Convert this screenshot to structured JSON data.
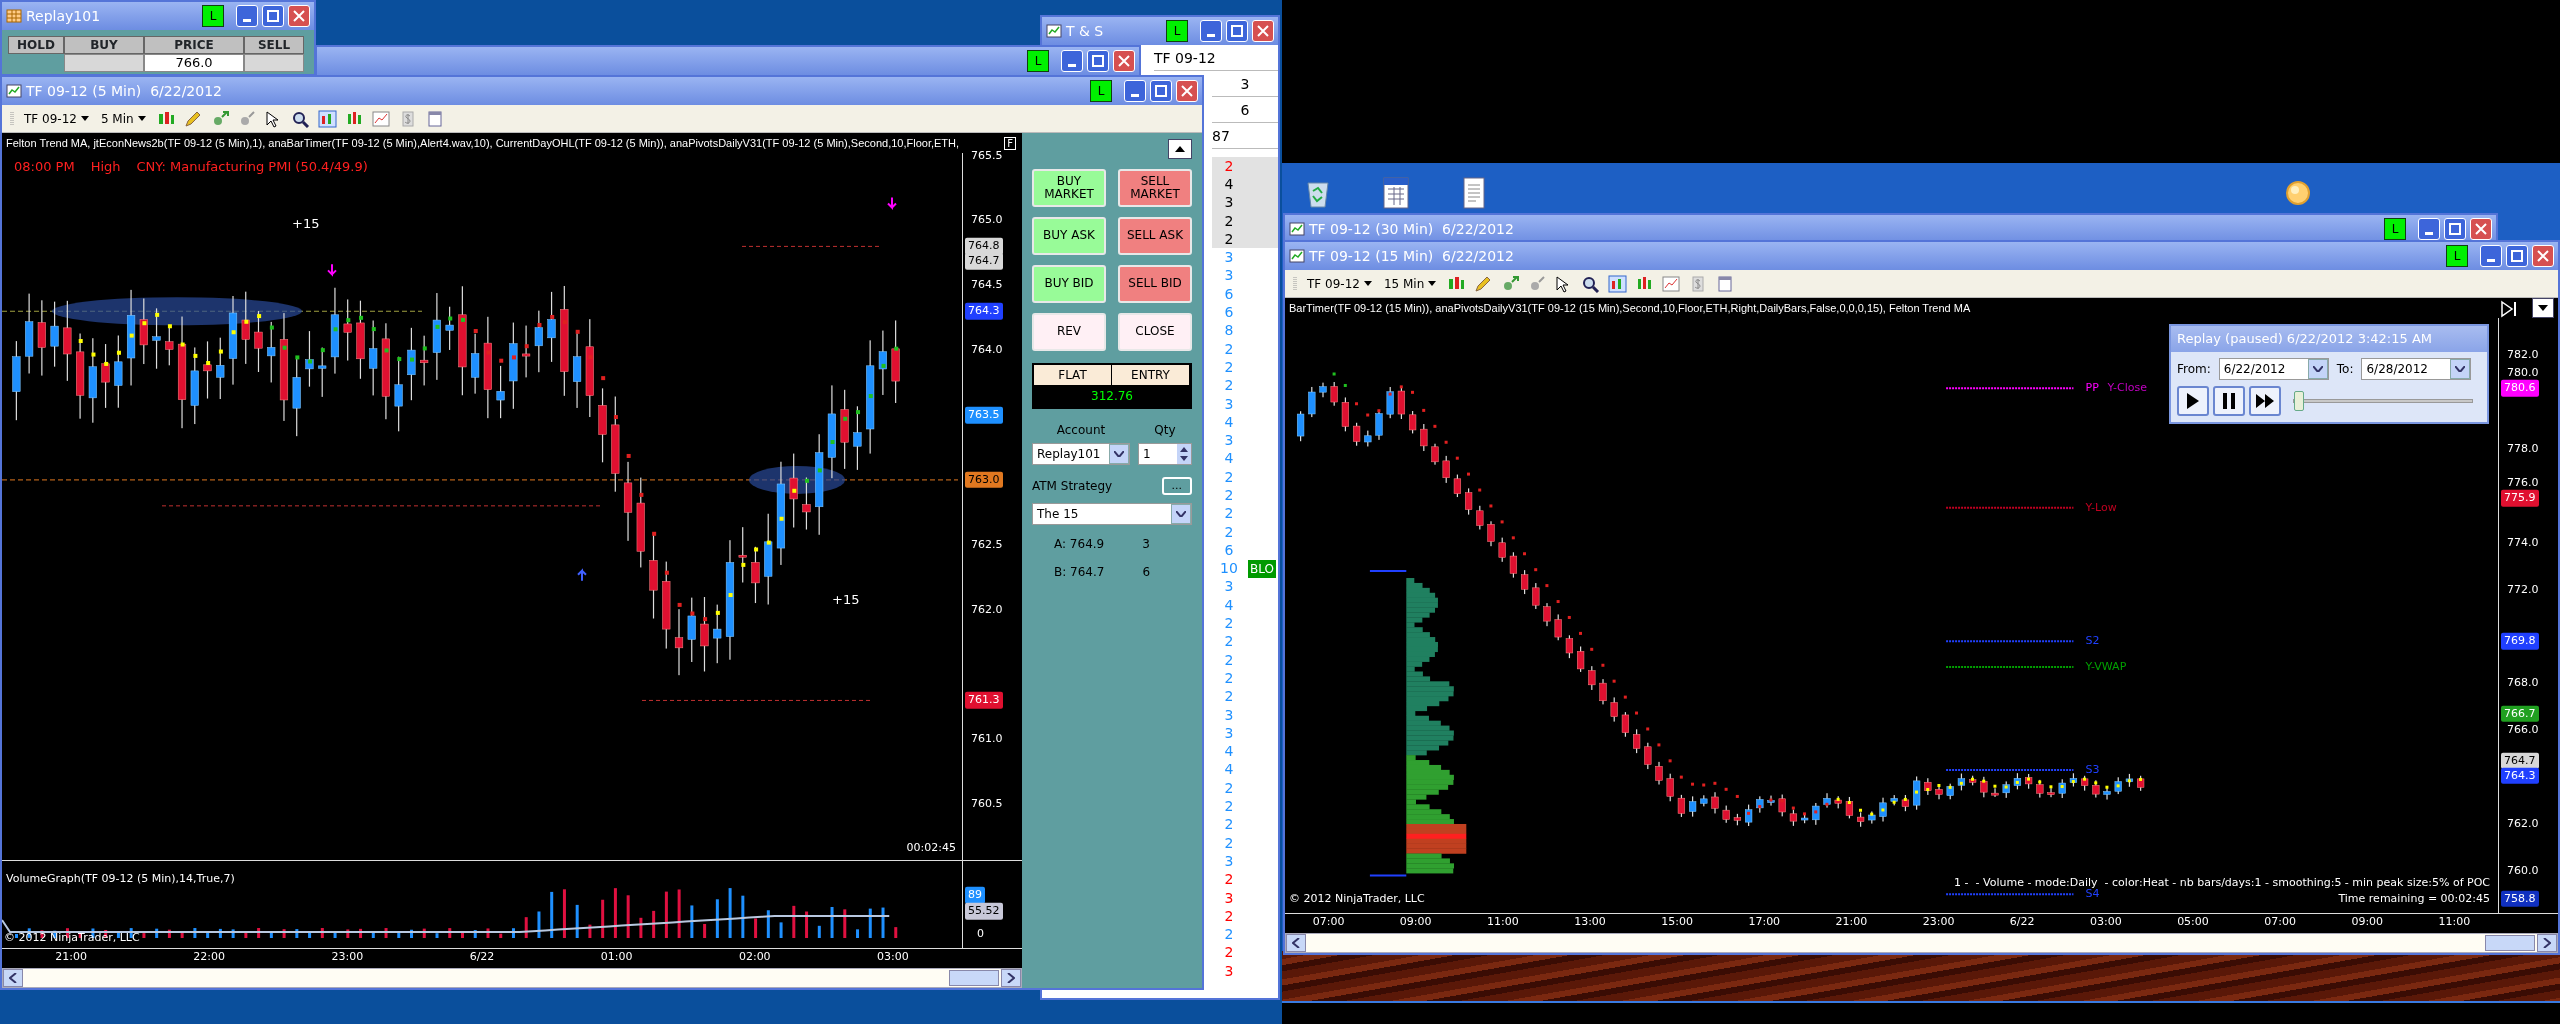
{
  "replay_account": {
    "title": "Replay101",
    "badge": "L",
    "columns": [
      "HOLD",
      "BUY",
      "PRICE",
      "SELL"
    ],
    "price": "766.0"
  },
  "hidden_window": {
    "badge": "L"
  },
  "time_and_sales": {
    "title": "T & S",
    "badge": "L",
    "header": [
      "TF 09-12",
      "3",
      "6",
      "87"
    ],
    "rows": [
      {
        "size": "2",
        "color": "#ff0000",
        "shaded": true
      },
      {
        "size": "4",
        "color": "#000000",
        "shaded": true
      },
      {
        "size": "3",
        "color": "#000000",
        "shaded": true
      },
      {
        "size": "2",
        "color": "#000000",
        "shaded": true
      },
      {
        "size": "2",
        "color": "#000000",
        "shaded": true
      },
      {
        "size": "3",
        "color": "#1e90ff",
        "shaded": false
      },
      {
        "size": "3",
        "color": "#1e90ff",
        "shaded": false
      },
      {
        "size": "6",
        "color": "#1e90ff",
        "shaded": false
      },
      {
        "size": "6",
        "color": "#1e90ff",
        "shaded": false
      },
      {
        "size": "8",
        "color": "#1e90ff",
        "shaded": false
      },
      {
        "size": "2",
        "color": "#1e90ff",
        "shaded": false
      },
      {
        "size": "2",
        "color": "#1e90ff",
        "shaded": false
      },
      {
        "size": "2",
        "color": "#1e90ff",
        "shaded": false
      },
      {
        "size": "3",
        "color": "#1e90ff",
        "shaded": false
      },
      {
        "size": "4",
        "color": "#1e90ff",
        "shaded": false
      },
      {
        "size": "3",
        "color": "#1e90ff",
        "shaded": false
      },
      {
        "size": "4",
        "color": "#1e90ff",
        "shaded": false
      },
      {
        "size": "2",
        "color": "#1e90ff",
        "shaded": false
      },
      {
        "size": "2",
        "color": "#1e90ff",
        "shaded": false
      },
      {
        "size": "2",
        "color": "#1e90ff",
        "shaded": false
      },
      {
        "size": "2",
        "color": "#1e90ff",
        "shaded": false
      },
      {
        "size": "6",
        "color": "#1e90ff",
        "shaded": false
      },
      {
        "size": "10",
        "color": "#1e90ff",
        "shaded": false,
        "tag": "BLO"
      },
      {
        "size": "3",
        "color": "#1e90ff",
        "shaded": false
      },
      {
        "size": "4",
        "color": "#1e90ff",
        "shaded": false
      },
      {
        "size": "2",
        "color": "#1e90ff",
        "shaded": false
      },
      {
        "size": "2",
        "color": "#1e90ff",
        "shaded": false
      },
      {
        "size": "2",
        "color": "#1e90ff",
        "shaded": false
      },
      {
        "size": "2",
        "color": "#1e90ff",
        "shaded": false
      },
      {
        "size": "2",
        "color": "#1e90ff",
        "shaded": false
      },
      {
        "size": "3",
        "color": "#1e90ff",
        "shaded": false
      },
      {
        "size": "3",
        "color": "#1e90ff",
        "shaded": false
      },
      {
        "size": "4",
        "color": "#1e90ff",
        "shaded": false
      },
      {
        "size": "4",
        "color": "#1e90ff",
        "shaded": false
      },
      {
        "size": "2",
        "color": "#1e90ff",
        "shaded": false
      },
      {
        "size": "2",
        "color": "#1e90ff",
        "shaded": false
      },
      {
        "size": "2",
        "color": "#1e90ff",
        "shaded": false
      },
      {
        "size": "2",
        "color": "#1e90ff",
        "shaded": false
      },
      {
        "size": "3",
        "color": "#1e90ff",
        "shaded": false
      },
      {
        "size": "2",
        "color": "#ff0000",
        "shaded": false
      },
      {
        "size": "3",
        "color": "#ff0000",
        "shaded": false
      },
      {
        "size": "2",
        "color": "#ff0000",
        "shaded": false
      },
      {
        "size": "2",
        "color": "#1e90ff",
        "shaded": false
      },
      {
        "size": "2",
        "color": "#ff0000",
        "shaded": false
      },
      {
        "size": "3",
        "color": "#ff0000",
        "shaded": false
      }
    ]
  },
  "chart_5min": {
    "title": "TF 09-12 (5 Min)  6/22/2012",
    "badge": "L",
    "instrument": "TF 09-12",
    "interval": "5 Min",
    "indicators": "Felton Trend MA, jtEconNews2b(TF 09-12 (5 Min),1), anaBarTimer(TF 09-12 (5 Min),Alert4.wav,10), CurrentDayOHL(TF 09-12 (5 Min)), anaPivotsDailyV31(TF 09-12 (5 Min),Second,10,Floor,ETH,",
    "flag": "F",
    "news": [
      "08:00 PM",
      "High",
      "CNY: Manufacturing PMI (50.4/49.9)"
    ],
    "annotations": [
      "+15",
      "+15"
    ],
    "price_ticks": [
      "765.5",
      "765.0",
      "764.5",
      "764.0",
      "762.5",
      "762.0",
      "761.0",
      "760.5"
    ],
    "price_tags": [
      {
        "text": "764.8",
        "color": "#d8d8d8"
      },
      {
        "text": "764.7",
        "color": "#d8d8d8"
      },
      {
        "text": "764.3",
        "color": "#2040ff"
      },
      {
        "text": "763.5",
        "color": "#1e90ff"
      },
      {
        "text": "763.0",
        "color": "#e07820"
      },
      {
        "text": "761.3",
        "color": "#e01030"
      }
    ],
    "timer": "00:02:45",
    "volume_label": "VolumeGraph(TF 09-12 (5 Min),14,True,7)",
    "volume_tags": [
      {
        "text": "89",
        "color": "#1e90ff"
      },
      {
        "text": "55.52",
        "color": "#c8c8d8"
      }
    ],
    "volume_tick": "0",
    "copyright": "© 2012 NinjaTrader, LLC",
    "time_axis": [
      "21:00",
      "22:00",
      "23:00",
      "6/22",
      "01:00",
      "02:00",
      "03:00"
    ]
  },
  "order_panel": {
    "buttons": [
      {
        "label": "BUY MARKET",
        "kind": "buy"
      },
      {
        "label": "SELL MARKET",
        "kind": "sell"
      },
      {
        "label": "BUY ASK",
        "kind": "buy"
      },
      {
        "label": "SELL ASK",
        "kind": "sell"
      },
      {
        "label": "BUY BID",
        "kind": "buy"
      },
      {
        "label": "SELL BID",
        "kind": "sell"
      },
      {
        "label": "REV",
        "kind": "neutral"
      },
      {
        "label": "CLOSE",
        "kind": "neutral"
      }
    ],
    "position": [
      "FLAT",
      "ENTRY"
    ],
    "pnl": "312.76",
    "account_label": "Account",
    "account": "Replay101",
    "qty_label": "Qty",
    "qty": "1",
    "atm_label": "ATM Strategy",
    "atm_button": "...",
    "atm": "The 15",
    "quotes": [
      {
        "label": "A: 764.9",
        "size": "3"
      },
      {
        "label": "B: 764.7",
        "size": "6"
      }
    ]
  },
  "chart_30min": {
    "title": "TF 09-12 (30 Min)  6/22/2012",
    "badge": "L"
  },
  "chart_15min": {
    "title": "TF 09-12 (15 Min)  6/22/2012",
    "badge": "L",
    "instrument": "TF 09-12",
    "interval": "15 Min",
    "indicators": "BarTimer(TF 09-12 (15 Min)), anaPivotsDailyV31(TF 09-12 (15 Min),Second,10,Floor,ETH,Right,DailyBars,False,0,0,0,15), Felton Trend MA",
    "price_ticks": [
      "782.0",
      "780.0",
      "778.0",
      "776.0",
      "774.0",
      "772.0",
      "768.0",
      "766.0",
      "762.0",
      "760.0"
    ],
    "price_tags": [
      {
        "text": "780.6",
        "color": "#ff00ff"
      },
      {
        "text": "775.9",
        "color": "#e01030"
      },
      {
        "text": "769.8",
        "color": "#2040ff"
      },
      {
        "text": "766.7",
        "color": "#20a020"
      },
      {
        "text": "764.7",
        "color": "#d8d8d8"
      },
      {
        "text": "764.3",
        "color": "#2040ff"
      },
      {
        "text": "758.8",
        "color": "#1030c0"
      }
    ],
    "pivots": [
      {
        "text": "PP",
        "color": "#ff00ff"
      },
      {
        "text": "Y-Close",
        "color": "#c000c0"
      },
      {
        "text": "Y-Low",
        "color": "#c00020"
      },
      {
        "text": "S2",
        "color": "#2040ff"
      },
      {
        "text": "Y-VWAP",
        "color": "#00a000"
      },
      {
        "text": "S3",
        "color": "#2040ff"
      },
      {
        "text": "S4",
        "color": "#2040ff"
      }
    ],
    "profile_info": "1 -  - Volume - mode:Daily  - color:Heat - nb bars/days:1 - smoothing:5 - min peak size:5% of POC",
    "time_remaining": "Time remaining = 00:02:45",
    "copyright": "© 2012 NinjaTrader, LLC",
    "time_axis": [
      "07:00",
      "09:00",
      "11:00",
      "13:00",
      "15:00",
      "17:00",
      "21:00",
      "23:00",
      "6/22",
      "03:00",
      "05:00",
      "07:00",
      "09:00",
      "11:00"
    ]
  },
  "replay": {
    "title": "Replay (paused) 6/22/2012 3:42:15 AM",
    "from_label": "From:",
    "from": "6/22/2012",
    "to_label": "To:",
    "to": "6/28/2012",
    "level": 0.03
  }
}
